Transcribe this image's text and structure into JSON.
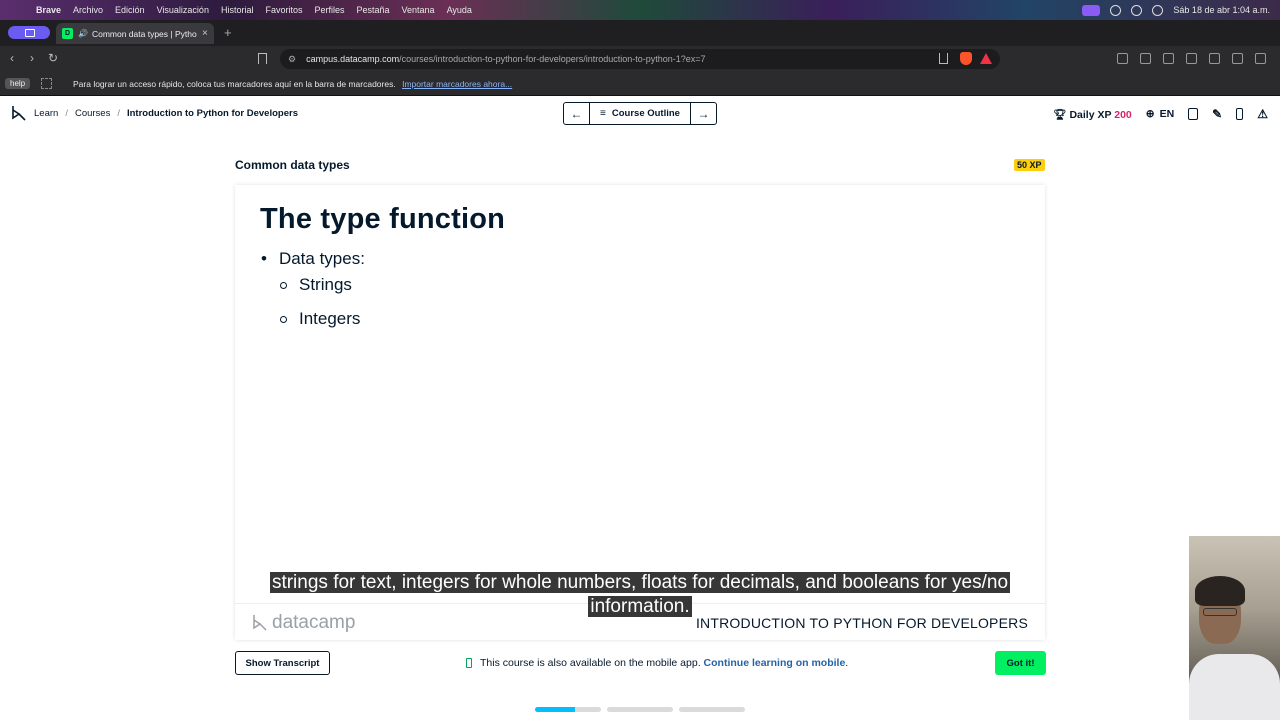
{
  "menubar": {
    "items": [
      "Brave",
      "Archivo",
      "Edición",
      "Visualización",
      "Historial",
      "Favoritos",
      "Perfiles",
      "Pestaña",
      "Ventana",
      "Ayuda"
    ],
    "datetime": "Sáb 18 de abr  1:04 a.m."
  },
  "browser": {
    "tab_title": "Common data types | Pytho",
    "url_host": "campus.datacamp.com",
    "url_path": "/courses/introduction-to-python-for-developers/introduction-to-python-1?ex=7",
    "bookmarks_help": "help",
    "bookmarks_msg": "Para lograr un acceso rápido, coloca tus marcadores aquí en la barra de marcadores.",
    "bookmarks_import": "Importar marcadores ahora..."
  },
  "header": {
    "breadcrumbs": [
      "Learn",
      "Courses",
      "Introduction to Python for Developers"
    ],
    "course_outline": "Course Outline",
    "daily_xp_label": "Daily XP",
    "daily_xp_value": "200",
    "language": "EN"
  },
  "lesson": {
    "title": "Common data types",
    "xp_badge": "50 XP"
  },
  "slide": {
    "heading": "The type function",
    "bullet": "Data types:",
    "subbullets": [
      "Strings",
      "Integers"
    ],
    "brand": "datacamp",
    "course_name": "INTRODUCTION TO PYTHON FOR DEVELOPERS"
  },
  "subtitle": "strings for text, integers for whole numbers, floats for decimals, and booleans for yes/no information.",
  "bottom": {
    "show_transcript": "Show Transcript",
    "mobile_msg": "This course is also available on the mobile app.",
    "mobile_link": "Continue learning on mobile",
    "mobile_end": ".",
    "got_it": "Got it!"
  },
  "progress": {
    "segments": [
      0.6,
      0,
      0
    ],
    "fill_color": "#06bdfc"
  },
  "colors": {
    "brand_green": "#03ef62",
    "navy": "#05192d",
    "xp_yellow": "#fcce0d"
  }
}
